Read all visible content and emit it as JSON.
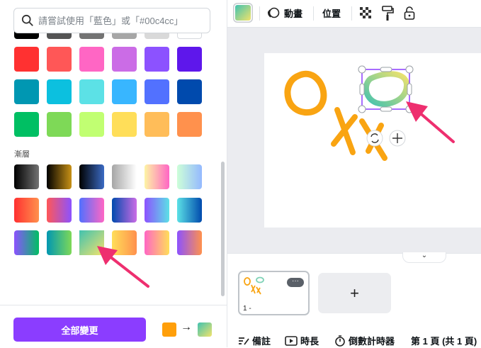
{
  "search": {
    "placeholder": "請嘗試使用「藍色」或「#00c4cc」"
  },
  "colors": {
    "row0": [
      "#000000",
      "#545454",
      "#737373",
      "#a6a6a6",
      "#d9d9d9",
      "#ffffff"
    ],
    "row1": [
      "#ff3131",
      "#ff5757",
      "#ff66c4",
      "#cb6ce6",
      "#8c52ff",
      "#5e17eb"
    ],
    "row2": [
      "#0097b2",
      "#0cc0df",
      "#5ce1e6",
      "#38b6ff",
      "#5271ff",
      "#004aad"
    ],
    "row3": [
      "#00bf63",
      "#7ed957",
      "#c1ff72",
      "#ffde59",
      "#ffbd59",
      "#ff914d"
    ]
  },
  "gradient_section": {
    "label": "漸層"
  },
  "gradients": {
    "row0": [
      "linear-gradient(90deg,#000000,#737373)",
      "linear-gradient(90deg,#000000,#c89116)",
      "linear-gradient(90deg,#000000,#3b6bc4)",
      "linear-gradient(90deg,#a6a6a6,#ffffff)",
      "linear-gradient(90deg,#fdf5a5,#ff66c4)",
      "linear-gradient(90deg,#cdffd8,#94b9ff)"
    ],
    "row1": [
      "linear-gradient(90deg,#ff3131,#ff914d)",
      "linear-gradient(90deg,#ff5757,#8c52ff)",
      "linear-gradient(90deg,#5170ff,#ff66c4)",
      "linear-gradient(90deg,#004aad,#cb6ce6)",
      "linear-gradient(90deg,#8c52ff,#5ce1e6)",
      "linear-gradient(90deg,#5ce1e6,#004aad)"
    ],
    "row2": [
      "linear-gradient(90deg,#8c52ff,#00bf63)",
      "linear-gradient(90deg,#0097b2,#7ed957)",
      "linear-gradient(135deg,#41c2b0,#f2e36b)",
      "linear-gradient(90deg,#ffde59,#ff914d)",
      "linear-gradient(90deg,#ff66c4,#ffde59)",
      "linear-gradient(90deg,#8c52ff,#ff914d)"
    ]
  },
  "footer": {
    "apply_label": "全部變更",
    "from_color": "#ff9f0a"
  },
  "toolbar": {
    "animate_label": "動畫",
    "position_label": "位置"
  },
  "pages": {
    "page_number": "1 -",
    "more_label": "···",
    "add_label": "+"
  },
  "bottom_bar": {
    "notes_label": "備註",
    "duration_label": "時長",
    "timer_label": "倒數計時器",
    "page_info": "第 1 頁 (共 1 頁)"
  },
  "annotation_color": "#ee2f6f"
}
